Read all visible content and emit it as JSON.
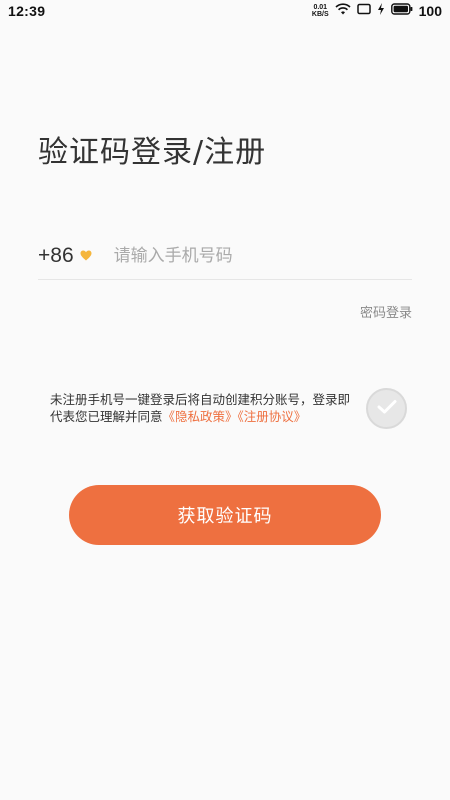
{
  "status_bar": {
    "time": "12:39",
    "net_speed_value": "0.01",
    "net_speed_unit": "KB/S",
    "battery": "100",
    "icons": [
      "wifi-icon",
      "screen-icon",
      "charging-icon",
      "battery-icon"
    ]
  },
  "page": {
    "title": "验证码登录/注册"
  },
  "phone": {
    "country_code": "+86",
    "placeholder": "请输入手机号码",
    "value": ""
  },
  "password_login_label": "密码登录",
  "agreement": {
    "text": "未注册手机号一键登录后将自动创建积分账号，登录即代表您已理解并同意",
    "privacy_link": "《隐私政策》",
    "register_link": "《注册协议》"
  },
  "get_code_button": "获取验证码",
  "colors": {
    "accent": "#ee7040",
    "arrow": "#f5b63c",
    "background": "#fafafa"
  }
}
